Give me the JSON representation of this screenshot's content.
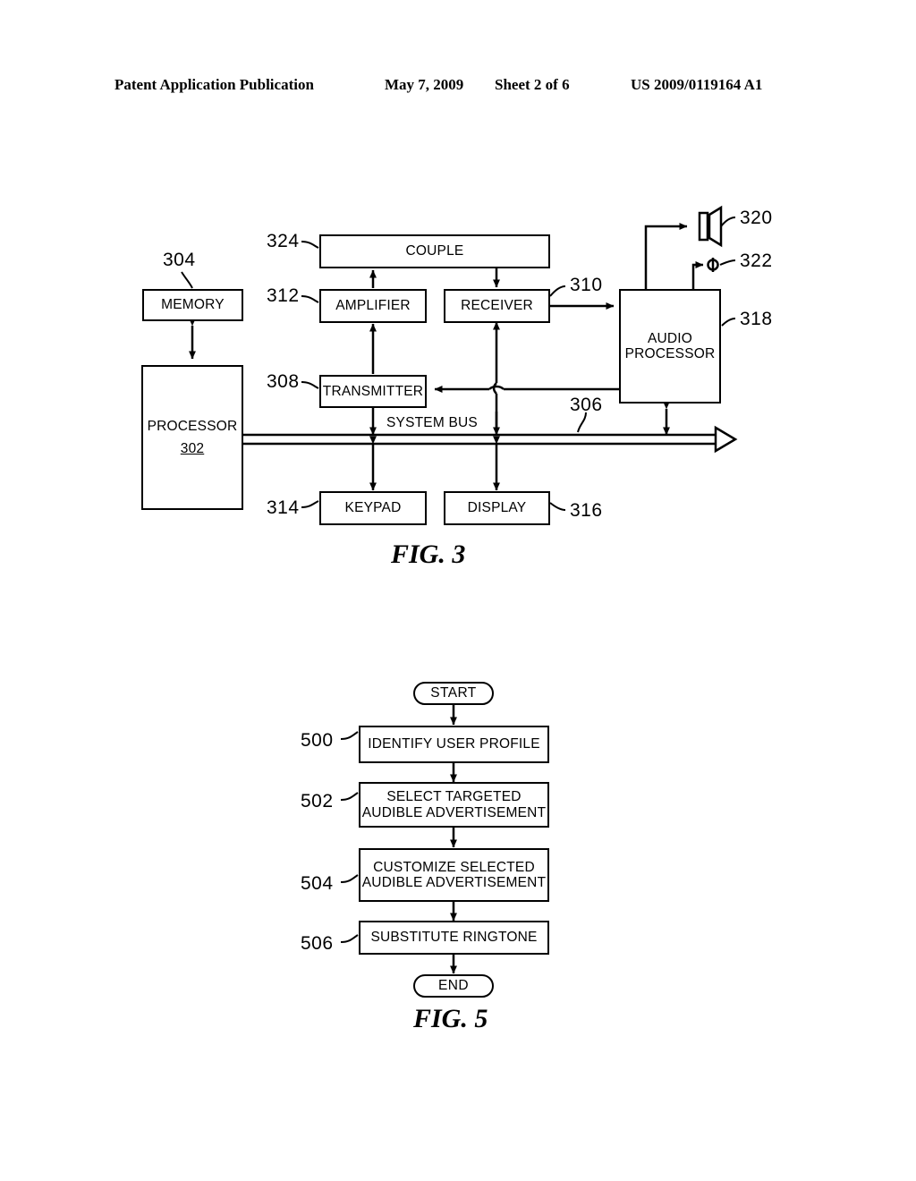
{
  "header": {
    "publication": "Patent Application Publication",
    "date": "May 7, 2009",
    "sheet": "Sheet 2 of 6",
    "patent_number": "US 2009/0119164 A1"
  },
  "figure3": {
    "caption": "FIG. 3",
    "bus_label": "SYSTEM BUS",
    "blocks": [
      {
        "id": "memory",
        "label": "MEMORY",
        "ref": "304"
      },
      {
        "id": "processor",
        "label": "PROCESSOR",
        "ref": "302"
      },
      {
        "id": "couple",
        "label": "COUPLE",
        "ref": "324"
      },
      {
        "id": "amplifier",
        "label": "AMPLIFIER",
        "ref": "312"
      },
      {
        "id": "receiver",
        "label": "RECEIVER",
        "ref": "310"
      },
      {
        "id": "transmitter",
        "label": "TRANSMITTER",
        "ref": "308"
      },
      {
        "id": "keypad",
        "label": "KEYPAD",
        "ref": "314"
      },
      {
        "id": "display",
        "label": "DISPLAY",
        "ref": "316"
      },
      {
        "id": "audio-processor",
        "label_line1": "AUDIO",
        "label_line2": "PROCESSOR",
        "ref": "318"
      },
      {
        "id": "speaker",
        "label": "",
        "ref": "320"
      },
      {
        "id": "microphone",
        "label": "",
        "ref": "322"
      },
      {
        "id": "system-bus",
        "label": "SYSTEM BUS",
        "ref": "306"
      }
    ],
    "refs": {
      "memory": "304",
      "processor": "302",
      "couple": "324",
      "amplifier": "312",
      "receiver": "310",
      "transmitter": "308",
      "keypad": "314",
      "display": "316",
      "audio_processor": "318",
      "speaker": "320",
      "microphone": "322",
      "system_bus": "306"
    },
    "labels": {
      "memory": "MEMORY",
      "processor": "PROCESSOR",
      "couple": "COUPLE",
      "amplifier": "AMPLIFIER",
      "receiver": "RECEIVER",
      "transmitter": "TRANSMITTER",
      "keypad": "KEYPAD",
      "display": "DISPLAY",
      "audio_processor_line1": "AUDIO",
      "audio_processor_line2": "PROCESSOR"
    }
  },
  "figure5": {
    "caption": "FIG. 5",
    "start_label": "START",
    "end_label": "END",
    "steps": [
      {
        "ref": "500",
        "line1": "IDENTIFY USER PROFILE",
        "line2": ""
      },
      {
        "ref": "502",
        "line1": "SELECT TARGETED",
        "line2": "AUDIBLE ADVERTISEMENT"
      },
      {
        "ref": "504",
        "line1": "CUSTOMIZE SELECTED",
        "line2": "AUDIBLE ADVERTISEMENT"
      },
      {
        "ref": "506",
        "line1": "SUBSTITUTE RINGTONE",
        "line2": ""
      }
    ]
  },
  "colors": {
    "ink": "#000000",
    "paper": "#ffffff"
  }
}
